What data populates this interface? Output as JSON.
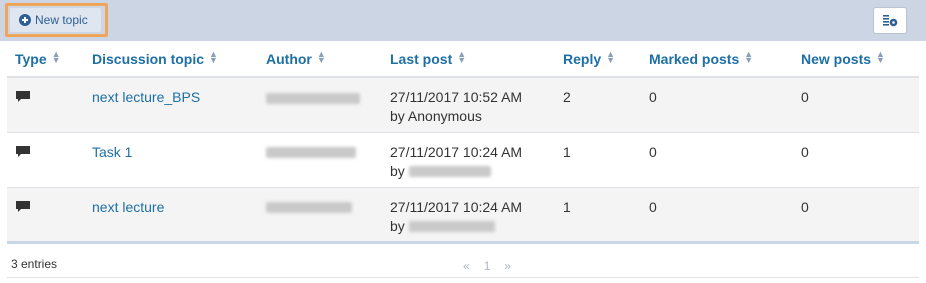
{
  "toolbar": {
    "new_topic_label": "New topic",
    "accent_color": "#2d5f93",
    "highlight_color": "#f0a65a",
    "settings_icon": "table-settings-icon"
  },
  "table": {
    "columns": [
      "Type",
      "Discussion topic",
      "Author",
      "Last post",
      "Reply",
      "Marked posts",
      "New posts"
    ],
    "rows": [
      {
        "type_icon": "speech-bubble-icon",
        "topic": "next lecture_BPS",
        "author": "",
        "last_post_date": "27/11/2017 10:52 AM",
        "last_post_by_prefix": "by",
        "last_post_by": "Anonymous",
        "reply": "2",
        "marked": "0",
        "new": "0"
      },
      {
        "type_icon": "speech-bubble-icon",
        "topic": "Task 1",
        "author": "",
        "last_post_date": "27/11/2017 10:24 AM",
        "last_post_by_prefix": "by",
        "last_post_by": "",
        "reply": "1",
        "marked": "0",
        "new": "0"
      },
      {
        "type_icon": "speech-bubble-icon",
        "topic": "next lecture",
        "author": "",
        "last_post_date": "27/11/2017 10:24 AM",
        "last_post_by_prefix": "by",
        "last_post_by": "",
        "reply": "1",
        "marked": "0",
        "new": "0"
      }
    ]
  },
  "footer": {
    "entries": "3 entries",
    "pager_prev": "«",
    "pager_page": "1",
    "pager_next": "»"
  }
}
